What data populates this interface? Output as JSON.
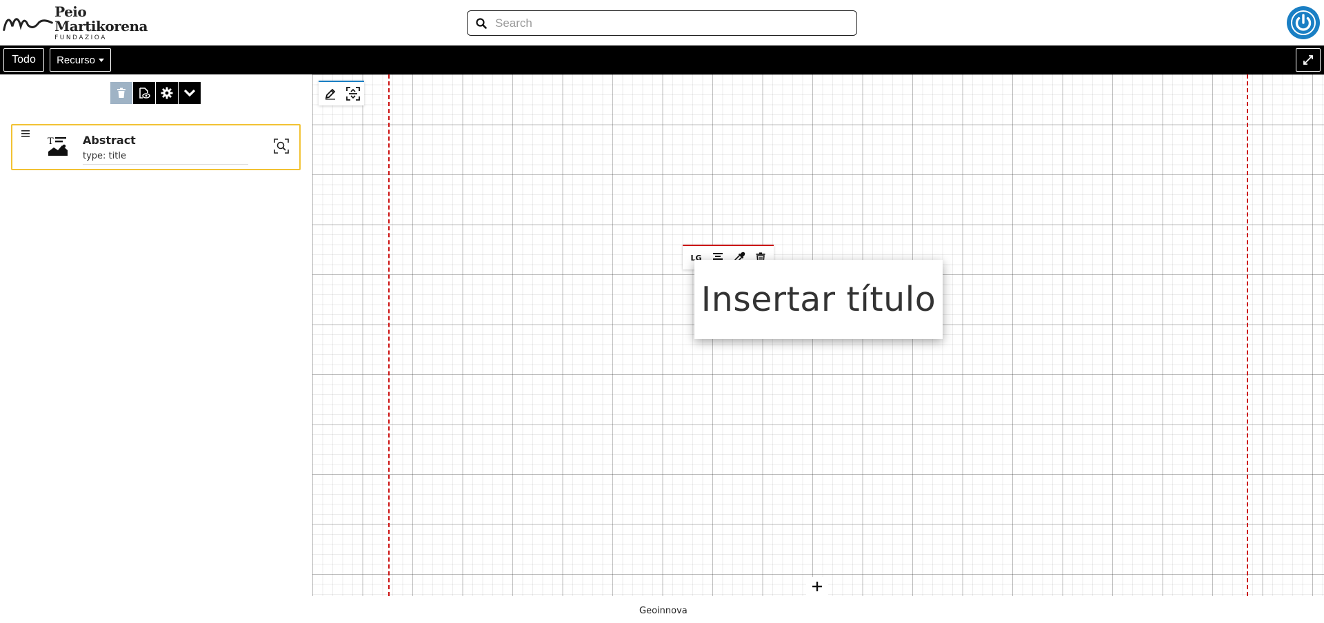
{
  "header": {
    "logo": {
      "line1": "Peio",
      "line2": "Martikorena",
      "line3": "FUNDAZIOA"
    },
    "search": {
      "placeholder": "Search",
      "value": ""
    }
  },
  "navbar": {
    "todo_label": "Todo",
    "recurso_label": "Recurso"
  },
  "sidebar": {
    "toolbar": [
      "trash-icon",
      "eye-off-icon",
      "gear-icon",
      "chevron-down-icon"
    ],
    "layers": [
      {
        "title": "Abstract",
        "subtitle": "type: title",
        "icon": "title-image-icon"
      }
    ]
  },
  "canvas": {
    "tools": [
      "pencil-icon",
      "fit-screen-icon"
    ],
    "element_toolbar": {
      "size_label": "LG",
      "tools": [
        "align-center-icon",
        "eyedropper-icon",
        "trash-icon"
      ]
    },
    "title_element": {
      "text": "Insertar título"
    }
  },
  "footer": {
    "text": "Geoinnova"
  },
  "colors": {
    "accent": "#1a7fc4",
    "guide": "#cc1111",
    "selection": "#f2c233"
  }
}
